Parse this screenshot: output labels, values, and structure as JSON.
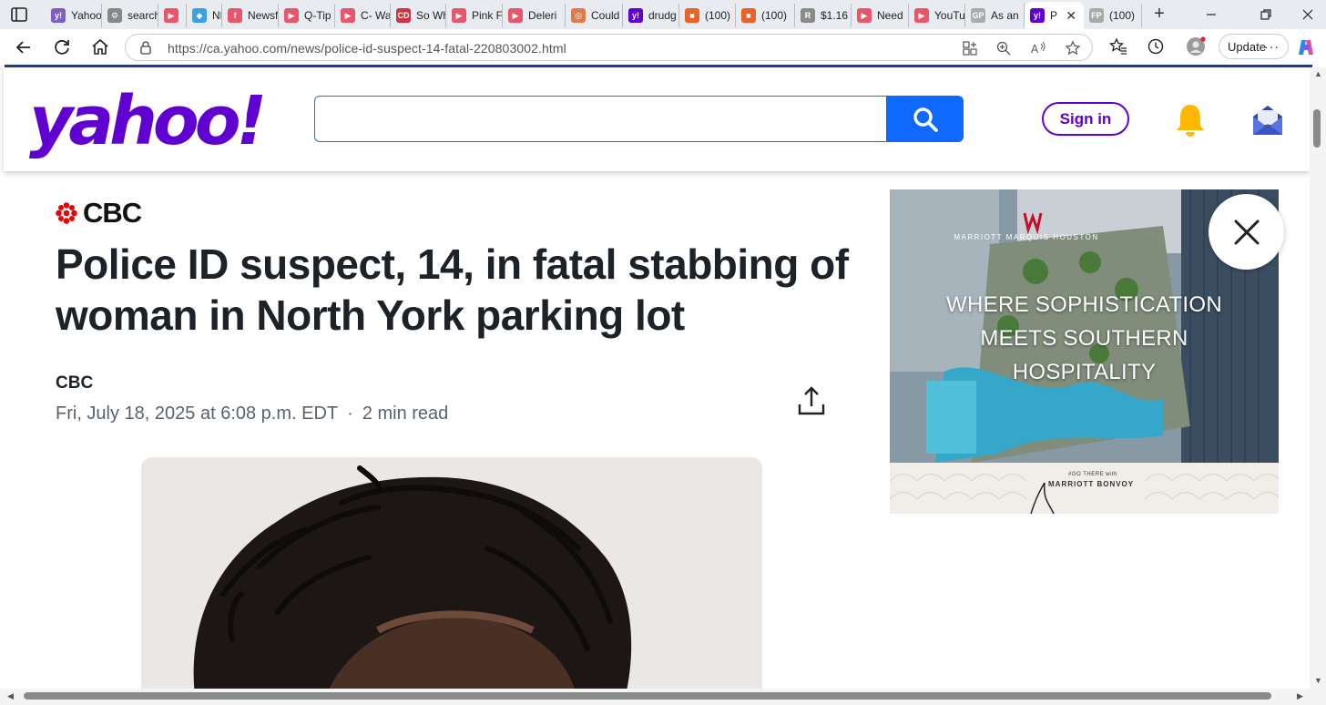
{
  "browser": {
    "tabs": [
      {
        "label": "Yahoo",
        "fav": "y!",
        "color": "#7b5fc6"
      },
      {
        "label": "search",
        "fav": "⚙",
        "color": "#888888"
      },
      {
        "label": "",
        "fav": "▶",
        "color": "#e8566b"
      },
      {
        "label": "NE",
        "fav": "◆",
        "color": "#3aa0e6"
      },
      {
        "label": "Newsf",
        "fav": "f",
        "color": "#e8566b"
      },
      {
        "label": "Q-Tip",
        "fav": "▶",
        "color": "#e8566b"
      },
      {
        "label": "C- Wa",
        "fav": "▶",
        "color": "#e8566b"
      },
      {
        "label": "So Wh",
        "fav": "CD",
        "color": "#cc3344"
      },
      {
        "label": "Pink F",
        "fav": "▶",
        "color": "#e8566b"
      },
      {
        "label": "Deleri",
        "fav": "▶",
        "color": "#e8566b"
      },
      {
        "label": "Could",
        "fav": "◎",
        "color": "#e07a4a"
      },
      {
        "label": "drudg",
        "fav": "y!",
        "color": "#6001d2"
      },
      {
        "label": "(100)",
        "fav": "■",
        "color": "#e8622a"
      },
      {
        "label": "(100)",
        "fav": "■",
        "color": "#e8622a"
      },
      {
        "label": "$1.16",
        "fav": "R",
        "color": "#8a8a8a"
      },
      {
        "label": "Need",
        "fav": "▶",
        "color": "#e8566b"
      },
      {
        "label": "YouTu",
        "fav": "▶",
        "color": "#e8566b"
      },
      {
        "label": "As an",
        "fav": "GP",
        "color": "#aaaaaa"
      },
      {
        "label": "P",
        "fav": "y!",
        "color": "#6001d2",
        "active": true
      },
      {
        "label": "(100)",
        "fav": "FP",
        "color": "#aaaaaa"
      }
    ],
    "new_tab_label": "+",
    "url": "https://ca.yahoo.com/news/police-id-suspect-14-fatal-220803002.html",
    "update_label": "Update",
    "update_menu": "···"
  },
  "site": {
    "logo_text": "yahoo!",
    "search_value": "",
    "signin_label": "Sign in",
    "colors": {
      "brand": "#6001d2",
      "search_button": "#0f69ff",
      "bell": "#ffb800"
    }
  },
  "article": {
    "source_name": "CBC",
    "headline": "Police ID suspect, 14, in fatal stabbing of woman in North York parking lot",
    "author": "CBC",
    "date": "Fri, July 18, 2025 at 6:08 p.m. EDT",
    "separator": "·",
    "read_time": "2 min read"
  },
  "ad": {
    "brand": "MARRIOTT MARQUIS HOUSTON",
    "headline_lines": [
      "WHERE SOPHISTICATION",
      "MEETS SOUTHERN",
      "HOSPITALITY"
    ],
    "footer_small": "#GO THERE with",
    "footer_brand": "MARRIOTT BONVOY"
  }
}
